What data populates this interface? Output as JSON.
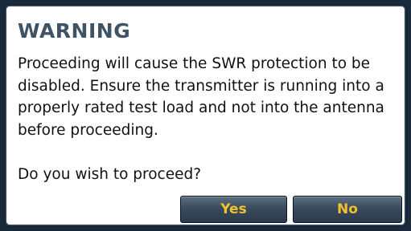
{
  "dialog": {
    "title": "WARNING",
    "message": "Proceeding will cause the SWR protection to be disabled. Ensure the transmitter is running into a properly rated test load and not into the antenna before proceeding.",
    "question": "Do you wish to proceed?",
    "yes_label": "Yes",
    "no_label": "No"
  },
  "colors": {
    "title": "#3e5366",
    "button_text": "#f2c12e",
    "button_bg": "#3b4b5e",
    "border": "#2a3f5a"
  }
}
